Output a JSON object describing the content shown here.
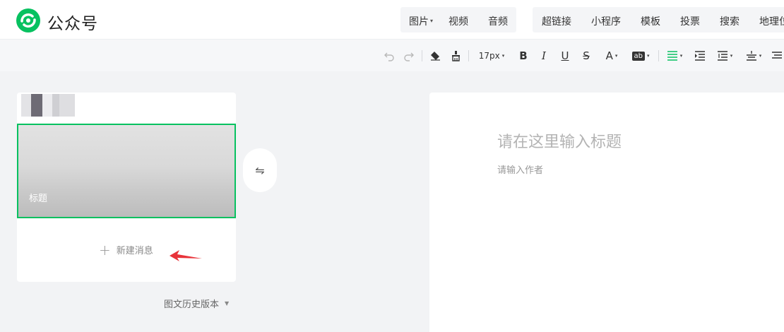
{
  "app": {
    "title": "公众号"
  },
  "colors": {
    "accent": "#07c160",
    "arrow": "#e8333a"
  },
  "toolbar_top": {
    "media": [
      {
        "label": "图片",
        "has_menu": true
      },
      {
        "label": "视频"
      },
      {
        "label": "音频"
      }
    ],
    "insert": [
      {
        "label": "超链接"
      },
      {
        "label": "小程序"
      },
      {
        "label": "模板"
      },
      {
        "label": "投票"
      },
      {
        "label": "搜索"
      },
      {
        "label": "地理位"
      }
    ]
  },
  "format_toolbar": {
    "icons": [
      "undo-icon",
      "redo-icon",
      "eraser-icon",
      "format-painter-icon",
      "bold-icon",
      "italic-icon",
      "underline-icon",
      "strikethrough-icon",
      "font-color-icon",
      "background-color-icon",
      "align-left-icon",
      "indent-icon",
      "line-spacing-icon",
      "paragraph-spacing-icon",
      "letter-spacing-icon"
    ],
    "font_size": "17px",
    "bold": "B",
    "italic": "I",
    "underline": "U",
    "strike": "S",
    "font_color": "A",
    "bg_color": "ab"
  },
  "sidebar": {
    "cover_title": "标题",
    "new_message": "新建消息",
    "history": "图文历史版本"
  },
  "editor": {
    "title_placeholder": "请在这里输入标题",
    "author_placeholder": "请输入作者"
  }
}
